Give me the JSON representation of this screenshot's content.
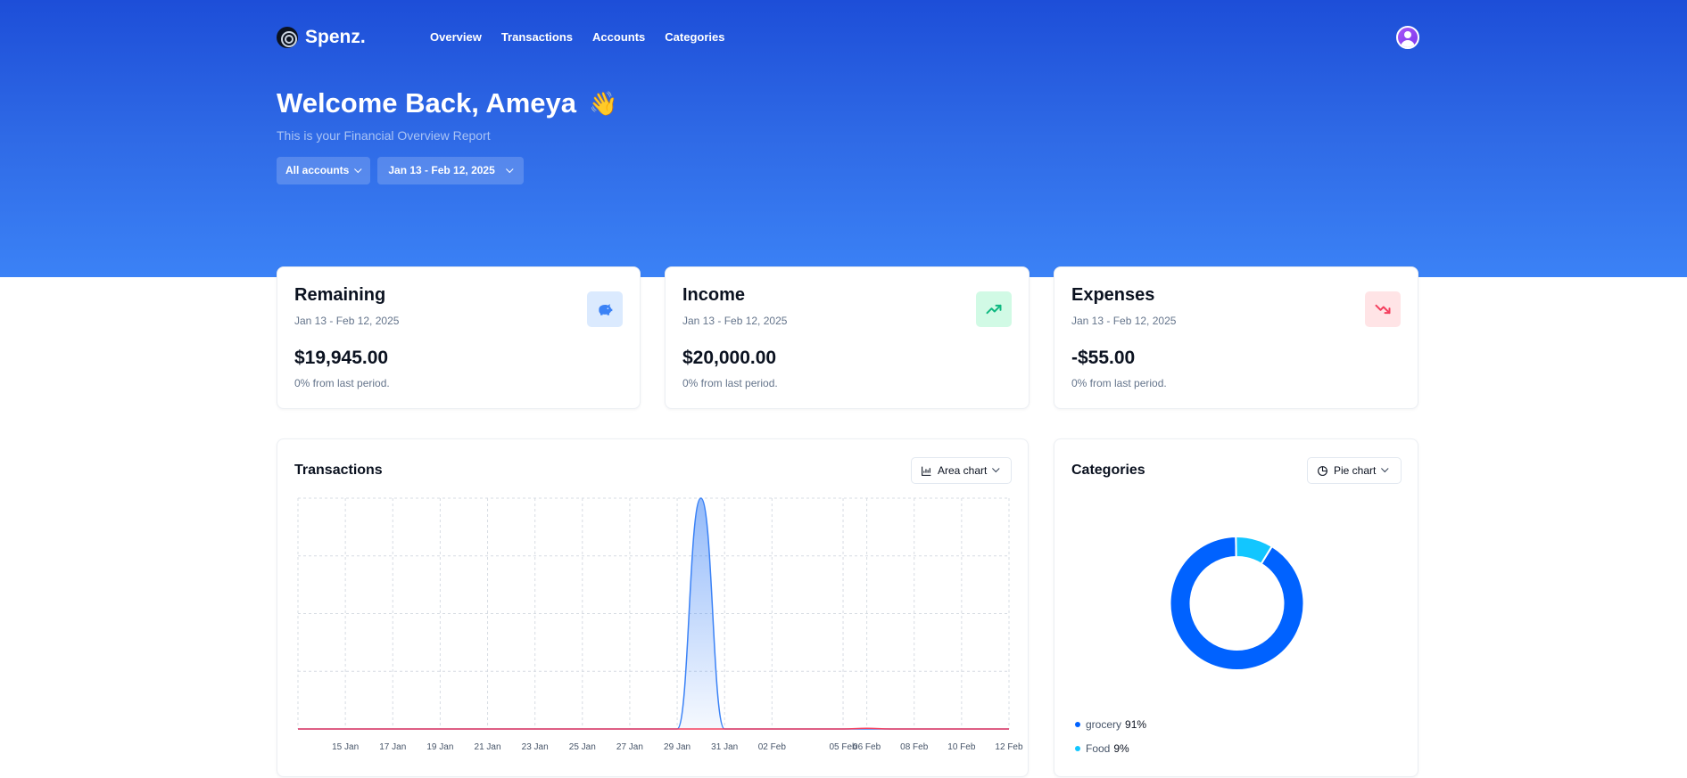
{
  "app": {
    "name": "Spenz."
  },
  "nav": {
    "items": [
      "Overview",
      "Transactions",
      "Accounts",
      "Categories"
    ]
  },
  "header": {
    "welcome": "Welcome Back, Ameya",
    "wave_emoji": "👋",
    "subtitle": "This is your Financial Overview Report",
    "account_filter": "All accounts",
    "date_filter": "Jan 13 - Feb 12, 2025"
  },
  "stats": [
    {
      "title": "Remaining",
      "range": "Jan 13 - Feb 12, 2025",
      "value": "$19,945.00",
      "change": "0% from last period.",
      "icon": "piggy-bank-icon",
      "color": "#3b82f6",
      "bg": "#dbeafe"
    },
    {
      "title": "Income",
      "range": "Jan 13 - Feb 12, 2025",
      "value": "$20,000.00",
      "change": "0% from last period.",
      "icon": "trending-up-icon",
      "color": "#10b981",
      "bg": "#d1fae5"
    },
    {
      "title": "Expenses",
      "range": "Jan 13 - Feb 12, 2025",
      "value": "-$55.00",
      "change": "0% from last period.",
      "icon": "trending-down-icon",
      "color": "#f43f5e",
      "bg": "#ffe4e6"
    }
  ],
  "transactions_panel": {
    "title": "Transactions",
    "chart_type_label": "Area chart"
  },
  "categories_panel": {
    "title": "Categories",
    "chart_type_label": "Pie chart",
    "legend": [
      {
        "name": "grocery",
        "pct": "91%",
        "color": "#0062ff"
      },
      {
        "name": "Food",
        "pct": "9%",
        "color": "#12c6ff"
      }
    ]
  },
  "chart_data": [
    {
      "type": "area",
      "x_ticks": [
        "15 Jan",
        "17 Jan",
        "19 Jan",
        "21 Jan",
        "23 Jan",
        "25 Jan",
        "27 Jan",
        "29 Jan",
        "31 Jan",
        "02 Feb",
        "05 Feb",
        "06 Feb",
        "08 Feb",
        "10 Feb",
        "12 Feb"
      ],
      "x": [
        "2025-01-13",
        "2025-01-14",
        "2025-01-15",
        "2025-01-16",
        "2025-01-17",
        "2025-01-18",
        "2025-01-19",
        "2025-01-20",
        "2025-01-21",
        "2025-01-22",
        "2025-01-23",
        "2025-01-24",
        "2025-01-25",
        "2025-01-26",
        "2025-01-27",
        "2025-01-28",
        "2025-01-29",
        "2025-01-30",
        "2025-01-31",
        "2025-02-01",
        "2025-02-02",
        "2025-02-03",
        "2025-02-04",
        "2025-02-05",
        "2025-02-06",
        "2025-02-07",
        "2025-02-08",
        "2025-02-09",
        "2025-02-10",
        "2025-02-11",
        "2025-02-12"
      ],
      "series": [
        {
          "values": [
            0,
            0,
            0,
            0,
            0,
            0,
            0,
            0,
            0,
            0,
            0,
            0,
            0,
            0,
            0,
            0,
            0,
            20000,
            0,
            0,
            0,
            0,
            0,
            0,
            0,
            0,
            0,
            0,
            0,
            0,
            0
          ],
          "color": "#3b82f6"
        },
        {
          "values": [
            0,
            0,
            0,
            0,
            0,
            0,
            0,
            0,
            0,
            0,
            0,
            0,
            0,
            0,
            0,
            0,
            0,
            0,
            0,
            0,
            0,
            0,
            0,
            0,
            55,
            0,
            0,
            0,
            0,
            0,
            0
          ],
          "color": "#f43f5e"
        }
      ],
      "grid": true
    },
    {
      "type": "pie",
      "categories": [
        "grocery",
        "Food"
      ],
      "values": [
        91,
        9
      ],
      "colors": [
        "#0062ff",
        "#12c6ff"
      ]
    }
  ]
}
